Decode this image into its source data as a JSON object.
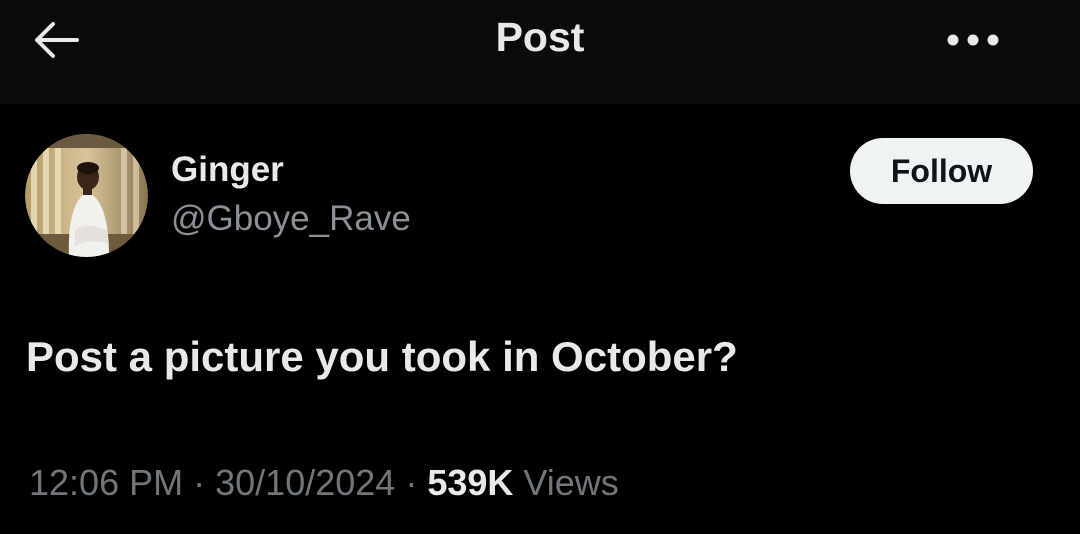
{
  "header": {
    "title": "Post",
    "back_icon": "arrow-left-icon",
    "more_icon": "more-horizontal-icon"
  },
  "post": {
    "author": {
      "name": "Ginger",
      "handle": "@Gboye_Rave",
      "avatar_icon": "user-avatar-photo"
    },
    "follow_label": "Follow",
    "text": "Post a picture you took in October?",
    "time": "12:06 PM",
    "separator": "·",
    "date": "30/10/2024",
    "views_count": "539K",
    "views_label": "Views"
  },
  "colors": {
    "background": "#000000",
    "header_background": "#0b0b0b",
    "primary_text": "#e7e9ea",
    "secondary_text": "#71767b",
    "follow_button_bg": "#eff3f4",
    "follow_button_text": "#0f1419"
  }
}
